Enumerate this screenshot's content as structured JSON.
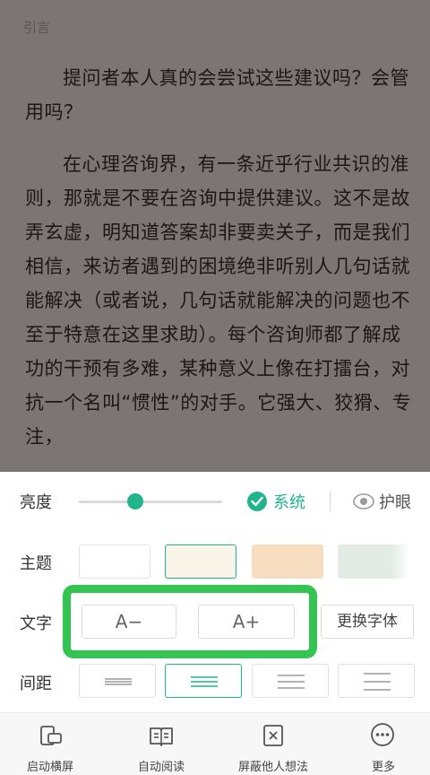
{
  "reader": {
    "chapter": "引言",
    "paragraph1": "提问者本人真的会尝试这些建议吗？会管用吗？",
    "paragraph2": "在心理咨询界，有一条近乎行业共识的准则，那就是不要在咨询中提供建议。这不是故弄玄虚，明知道答案却非要卖关子，而是我们相信，来访者遇到的困境绝非听别人几句话就能解决（或者说，几句话就能解决的问题也不至于特意在这里求助）。每个咨询师都了解成功的干预有多难，某种意义上像在打擂台，对抗一个名叫“惯性”的对手。它强大、狡猾、专注，"
  },
  "settings": {
    "brightness_label": "亮度",
    "brightness_level": 0.39,
    "system_label": "系统",
    "eye_label": "护眼",
    "theme_label": "主题",
    "theme_colors": [
      "#ffffff",
      "#f8f4e8",
      "#f6ddbf",
      "#e3ece4"
    ],
    "selected_theme": 1,
    "text_label": "文字",
    "font_smaller": "A−",
    "font_larger": "A+",
    "change_font": "更换字体",
    "spacing_label": "间距",
    "selected_spacing": 1,
    "accent_color": "#21b48d",
    "highlight_color": "#35c352"
  },
  "toolbar": {
    "items": [
      {
        "label": "启动横屏",
        "icon": "rotate-screen-icon"
      },
      {
        "label": "自动阅读",
        "icon": "open-book-icon"
      },
      {
        "label": "屏蔽他人想法",
        "icon": "block-box-icon"
      },
      {
        "label": "更多",
        "icon": "more-dots-icon"
      }
    ]
  }
}
